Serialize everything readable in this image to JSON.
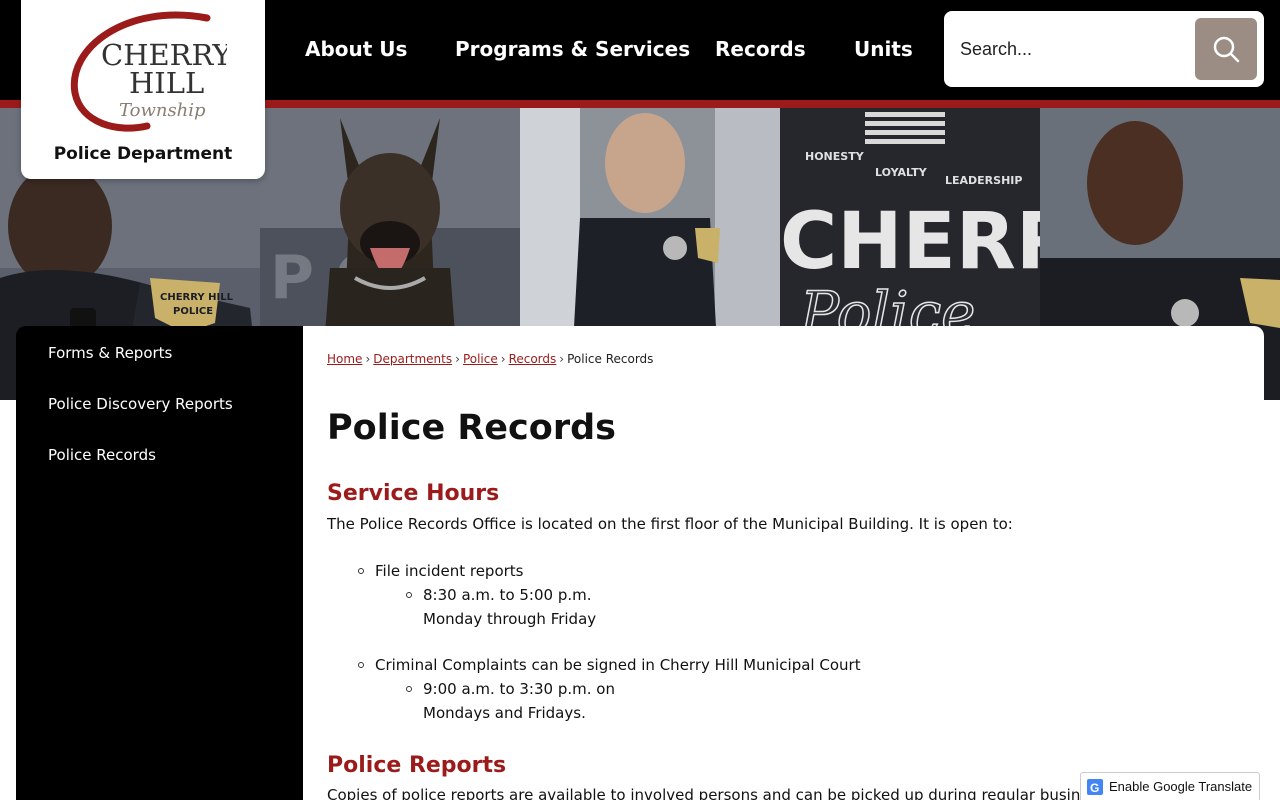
{
  "logo": {
    "line1": "CHERRY",
    "line2": "HILL",
    "line3": "Township",
    "subtitle": "Police Department"
  },
  "nav": {
    "items": [
      "About Us",
      "Programs & Services",
      "Records",
      "Units"
    ]
  },
  "search": {
    "placeholder": "Search..."
  },
  "hero": {
    "shirt_text": "CHERRY HILL POLICE N.J.",
    "poster_words": [
      "HONESTY",
      "LOYALTY",
      "LEADERSHIP"
    ],
    "poster_big": "CHERRY",
    "poster_script": "Police"
  },
  "sidebar": {
    "items": [
      "Forms & Reports",
      "Police Discovery Reports",
      "Police Records"
    ]
  },
  "breadcrumb": {
    "links": [
      "Home",
      "Departments",
      "Police",
      "Records"
    ],
    "current": "Police Records"
  },
  "content": {
    "title": "Police Records",
    "section1_heading": "Service Hours",
    "section1_intro": "The Police Records Office is located on the first floor of the Municipal Building. It is open to:",
    "item1": "File incident reports",
    "item1_sub1": "8:30 a.m. to 5:00 p.m.",
    "item1_sub2": "Monday through Friday",
    "item2": "Criminal Complaints can be signed in Cherry Hill Municipal Court",
    "item2_sub1": "9:00 a.m. to 3:30 p.m. on",
    "item2_sub2": "Mondays and Fridays.",
    "section2_heading": "Police Reports",
    "section2_intro": "Copies of police reports are available to involved persons and can be picked up during regular business hours at the"
  },
  "translate": {
    "label": "Enable Google Translate"
  },
  "colors": {
    "brand_red": "#9b1b1b",
    "header_black": "#000000",
    "search_button": "#9b8d83"
  }
}
